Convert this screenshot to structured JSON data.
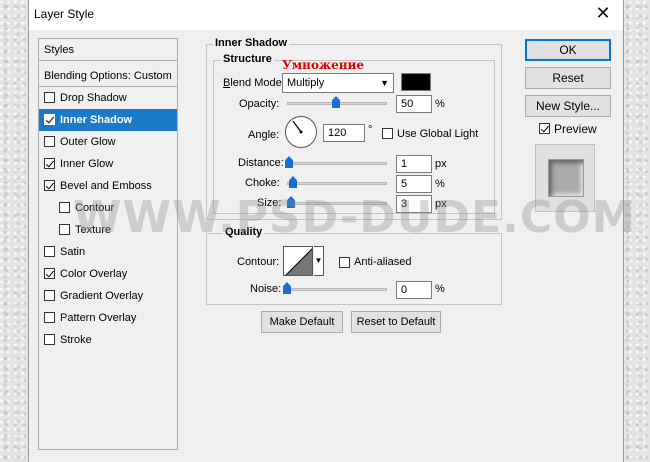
{
  "window": {
    "title": "Layer Style"
  },
  "styles_list": {
    "header": "Styles",
    "blending": "Blending Options: Custom",
    "items": [
      {
        "label": "Drop Shadow",
        "checked": false,
        "indent": false,
        "selected": false
      },
      {
        "label": "Inner Shadow",
        "checked": true,
        "indent": false,
        "selected": true
      },
      {
        "label": "Outer Glow",
        "checked": false,
        "indent": false,
        "selected": false
      },
      {
        "label": "Inner Glow",
        "checked": true,
        "indent": false,
        "selected": false
      },
      {
        "label": "Bevel and Emboss",
        "checked": true,
        "indent": false,
        "selected": false
      },
      {
        "label": "Contour",
        "checked": false,
        "indent": true,
        "selected": false
      },
      {
        "label": "Texture",
        "checked": false,
        "indent": true,
        "selected": false
      },
      {
        "label": "Satin",
        "checked": false,
        "indent": false,
        "selected": false
      },
      {
        "label": "Color Overlay",
        "checked": true,
        "indent": false,
        "selected": false
      },
      {
        "label": "Gradient Overlay",
        "checked": false,
        "indent": false,
        "selected": false
      },
      {
        "label": "Pattern Overlay",
        "checked": false,
        "indent": false,
        "selected": false
      },
      {
        "label": "Stroke",
        "checked": false,
        "indent": false,
        "selected": false
      }
    ]
  },
  "inner_shadow": {
    "section_title": "Inner Shadow",
    "structure_title": "Structure",
    "annotation": "Умножение",
    "blend_mode_label": "Blend Mode:",
    "blend_mode_value": "Multiply",
    "shadow_color": "#000000",
    "opacity_label": "Opacity:",
    "opacity_value": "50",
    "opacity_unit": "%",
    "angle_label": "Angle:",
    "angle_value": "120",
    "angle_unit": "°",
    "global_light_label": "Use Global Light",
    "global_light_checked": false,
    "distance_label": "Distance:",
    "distance_value": "1",
    "distance_unit": "px",
    "choke_label": "Choke:",
    "choke_value": "5",
    "choke_unit": "%",
    "size_label": "Size:",
    "size_value": "3",
    "size_unit": "px"
  },
  "quality": {
    "title": "Quality",
    "contour_label": "Contour:",
    "anti_aliased_label": "Anti-aliased",
    "anti_aliased_checked": false,
    "noise_label": "Noise:",
    "noise_value": "0",
    "noise_unit": "%"
  },
  "buttons": {
    "make_default": "Make Default",
    "reset_default": "Reset to Default",
    "ok": "OK",
    "reset": "Reset",
    "new_style": "New Style...",
    "preview_label": "Preview",
    "preview_checked": true
  },
  "watermark": "WWW.PSD-DUDE.COM",
  "colors": {
    "accent": "#1b7ac8",
    "annotation": "#e00000"
  }
}
